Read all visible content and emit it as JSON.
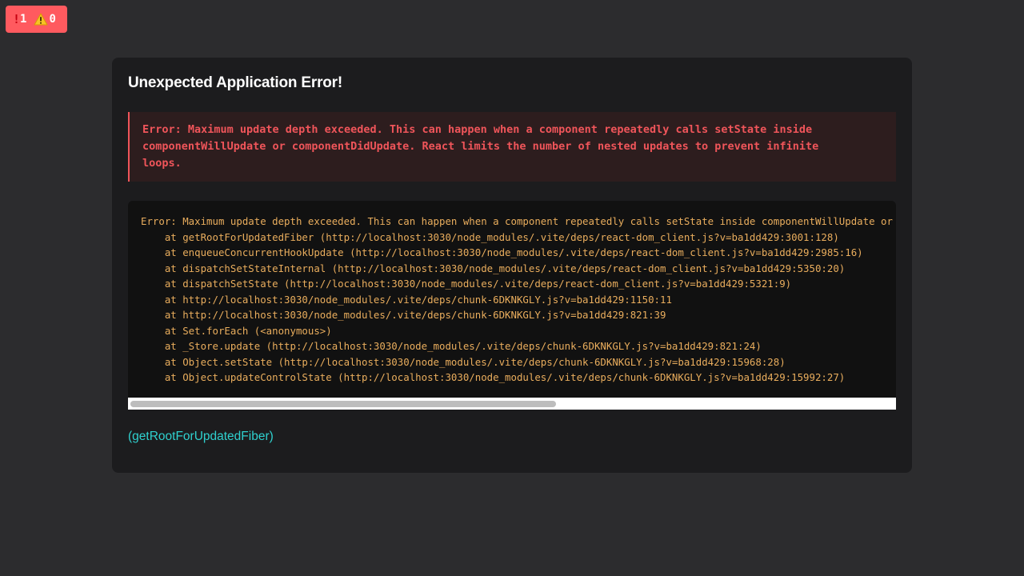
{
  "badge": {
    "error_icon": "!",
    "error_count": "1",
    "warning_icon": "warning-triangle",
    "warning_count": "0"
  },
  "error_overlay": {
    "title": "Unexpected Application Error!",
    "message": "Error: Maximum update depth exceeded. This can happen when a component repeatedly calls setState inside componentWillUpdate or componentDidUpdate. React limits the number of nested updates to prevent infinite loops.",
    "stack_lines": [
      "Error: Maximum update depth exceeded. This can happen when a component repeatedly calls setState inside componentWillUpdate or componentDidUpdate. React limits the number of nested updates to prevent infinite loops.",
      "    at getRootForUpdatedFiber (http://localhost:3030/node_modules/.vite/deps/react-dom_client.js?v=ba1dd429:3001:128)",
      "    at enqueueConcurrentHookUpdate (http://localhost:3030/node_modules/.vite/deps/react-dom_client.js?v=ba1dd429:2985:16)",
      "    at dispatchSetStateInternal (http://localhost:3030/node_modules/.vite/deps/react-dom_client.js?v=ba1dd429:5350:20)",
      "    at dispatchSetState (http://localhost:3030/node_modules/.vite/deps/react-dom_client.js?v=ba1dd429:5321:9)",
      "    at http://localhost:3030/node_modules/.vite/deps/chunk-6DKNKGLY.js?v=ba1dd429:1150:11",
      "    at http://localhost:3030/node_modules/.vite/deps/chunk-6DKNKGLY.js?v=ba1dd429:821:39",
      "    at Set.forEach (<anonymous>)",
      "    at _Store.update (http://localhost:3030/node_modules/.vite/deps/chunk-6DKNKGLY.js?v=ba1dd429:821:24)",
      "    at Object.setState (http://localhost:3030/node_modules/.vite/deps/chunk-6DKNKGLY.js?v=ba1dd429:15968:28)",
      "    at Object.updateControlState (http://localhost:3030/node_modules/.vite/deps/chunk-6DKNKGLY.js?v=ba1dd429:15992:27)"
    ],
    "function_link": "(getRootForUpdatedFiber)"
  },
  "colors": {
    "page_background": "#2c2c2e",
    "card_background": "#1c1c1e",
    "badge_background": "#ff5a5f",
    "error_text": "#f0555a",
    "message_background": "#2d1d1e",
    "stack_text": "#e9ad5d",
    "stack_background": "#111111",
    "link": "#2fd1cf"
  }
}
